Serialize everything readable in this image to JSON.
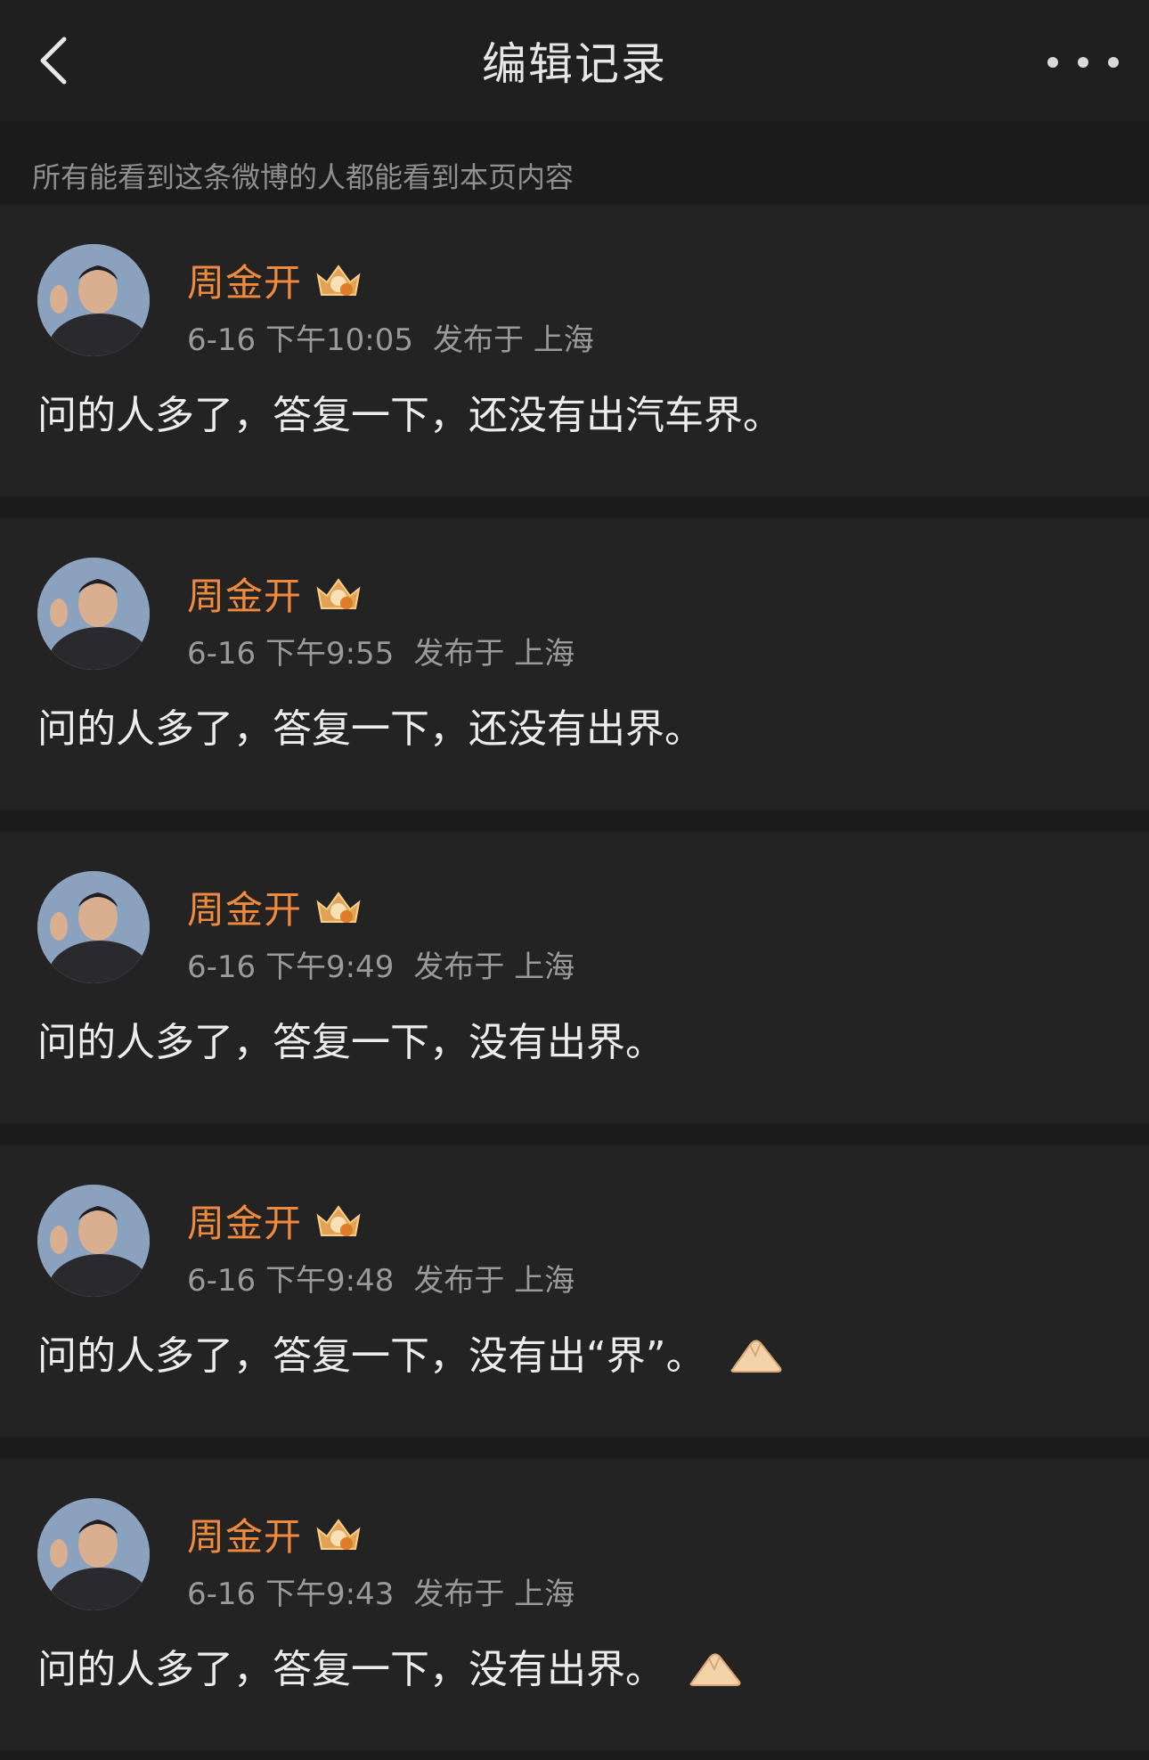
{
  "header": {
    "title": "编辑记录",
    "back_icon": "chevron-left-icon",
    "more_icon": "more-dots-icon"
  },
  "notice": "所有能看到这条微博的人都能看到本页内容",
  "colors": {
    "background": "#1b1b1b",
    "card": "#232323",
    "name": "#f18a3a",
    "meta": "#9a9a9a",
    "text": "#ececec"
  },
  "records": [
    {
      "name": "周金开",
      "time": "6-16 下午10:05",
      "location": "发布于 上海",
      "content": "问的人多了，答复一下，还没有出汽车界。",
      "has_emoji": false
    },
    {
      "name": "周金开",
      "time": "6-16 下午9:55",
      "location": "发布于 上海",
      "content": "问的人多了，答复一下，还没有出界。",
      "has_emoji": false
    },
    {
      "name": "周金开",
      "time": "6-16 下午9:49",
      "location": "发布于 上海",
      "content": "问的人多了，答复一下，没有出界。",
      "has_emoji": false
    },
    {
      "name": "周金开",
      "time": "6-16 下午9:48",
      "location": "发布于 上海",
      "content": "问的人多了，答复一下，没有出“界”。",
      "has_emoji": true
    },
    {
      "name": "周金开",
      "time": "6-16 下午9:43",
      "location": "发布于 上海",
      "content": "问的人多了，答复一下，没有出界。",
      "has_emoji": true
    }
  ]
}
